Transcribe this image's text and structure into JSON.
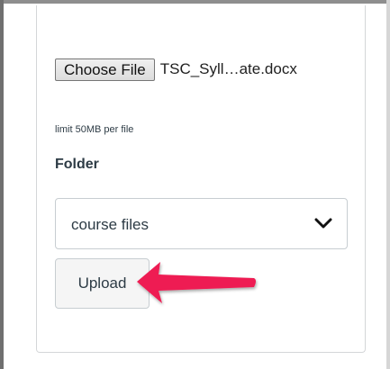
{
  "upload_form": {
    "choose_file_label": "Choose File",
    "selected_file_name": "TSC_Syll…ate.docx",
    "limit_note": "limit 50MB per file",
    "folder_label": "Folder",
    "folder_select_value": "course files",
    "upload_label": "Upload"
  },
  "icons": {
    "dropdown": "chevron-down-icon",
    "annotation": "arrow-pointer-icon"
  },
  "colors": {
    "annotation_arrow": "#ee1d52",
    "text": "#2d3b45",
    "border": "#c7cdd1"
  }
}
